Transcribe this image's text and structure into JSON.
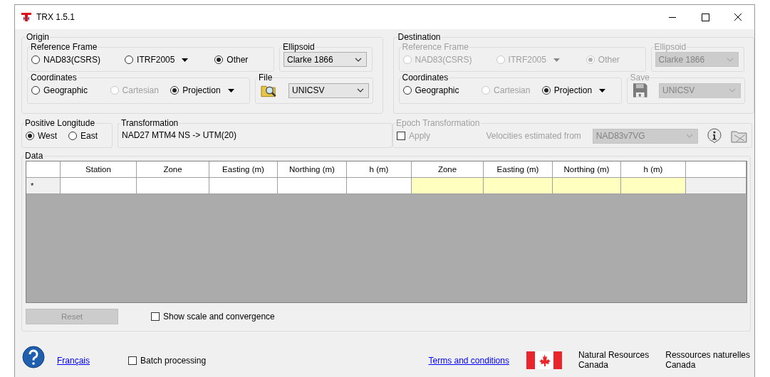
{
  "window": {
    "title": "TRX 1.5.1"
  },
  "origin": {
    "title": "Origin",
    "reference_frame": {
      "title": "Reference Frame",
      "disabled": false,
      "options": [
        {
          "label": "NAD83(CSRS)",
          "selected": false,
          "disabled": false,
          "has_menu": false
        },
        {
          "label": "ITRF2005",
          "selected": false,
          "disabled": false,
          "has_menu": true
        },
        {
          "label": "Other",
          "selected": true,
          "disabled": false,
          "has_menu": false
        }
      ]
    },
    "ellipsoid": {
      "title": "Ellipsoid",
      "value": "Clarke 1866",
      "disabled": false
    },
    "coordinates": {
      "title": "Coordinates",
      "disabled": false,
      "options": [
        {
          "label": "Geographic",
          "selected": false,
          "disabled": false,
          "has_menu": false
        },
        {
          "label": "Cartesian",
          "selected": false,
          "disabled": true,
          "has_menu": false
        },
        {
          "label": "Projection",
          "selected": true,
          "disabled": false,
          "has_menu": true
        }
      ]
    },
    "file": {
      "title": "File",
      "value": "UNICSV",
      "disabled": false
    }
  },
  "destination": {
    "title": "Destination",
    "reference_frame": {
      "title": "Reference Frame",
      "disabled": true,
      "options": [
        {
          "label": "NAD83(CSRS)",
          "selected": false,
          "disabled": true,
          "has_menu": false
        },
        {
          "label": "ITRF2005",
          "selected": false,
          "disabled": true,
          "has_menu": true
        },
        {
          "label": "Other",
          "selected": true,
          "disabled": true,
          "has_menu": false
        }
      ]
    },
    "ellipsoid": {
      "title": "Ellipsoid",
      "value": "Clarke 1866",
      "disabled": true
    },
    "coordinates": {
      "title": "Coordinates",
      "disabled": false,
      "options": [
        {
          "label": "Geographic",
          "selected": false,
          "disabled": false,
          "has_menu": false
        },
        {
          "label": "Cartesian",
          "selected": false,
          "disabled": true,
          "has_menu": false
        },
        {
          "label": "Projection",
          "selected": true,
          "disabled": false,
          "has_menu": true
        }
      ]
    },
    "file": {
      "title": "Save",
      "value": "UNICSV",
      "disabled": true
    }
  },
  "positive_longitude": {
    "title": "Positive Longitude",
    "options": [
      {
        "label": "West",
        "selected": true,
        "disabled": false,
        "has_menu": false
      },
      {
        "label": "East",
        "selected": false,
        "disabled": false,
        "has_menu": false
      }
    ]
  },
  "transformation": {
    "title": "Transformation",
    "value": "NAD27 MTM4 NS -> UTM(20)"
  },
  "epoch": {
    "title": "Epoch Transformation",
    "disabled": true,
    "apply": {
      "label": "Apply",
      "checked": false
    },
    "velocities_label": "Velocities estimated from",
    "velocities_value": "NAD83v7VG"
  },
  "data": {
    "title": "Data",
    "columns": [
      {
        "label": "Station",
        "kind": "origin"
      },
      {
        "label": "Zone",
        "kind": "origin"
      },
      {
        "label": "Easting (m)",
        "kind": "origin"
      },
      {
        "label": "Northing (m)",
        "kind": "origin"
      },
      {
        "label": "h (m)",
        "kind": "origin"
      },
      {
        "label": "Zone",
        "kind": "destination"
      },
      {
        "label": "Easting (m)",
        "kind": "destination"
      },
      {
        "label": "Northing (m)",
        "kind": "destination"
      },
      {
        "label": "h (m)",
        "kind": "destination"
      }
    ],
    "rows": [
      {
        "marker": "*"
      }
    ],
    "reset": {
      "label": "Reset",
      "disabled": true
    },
    "show_scale": {
      "label": "Show scale and convergence",
      "checked": false
    }
  },
  "footer": {
    "language_link": "Français",
    "batch": {
      "label": "Batch processing",
      "checked": false
    },
    "terms_link": "Terms and conditions",
    "agency": [
      [
        "Natural Resources",
        "Canada"
      ],
      [
        "Ressources naturelles",
        "Canada"
      ]
    ]
  }
}
